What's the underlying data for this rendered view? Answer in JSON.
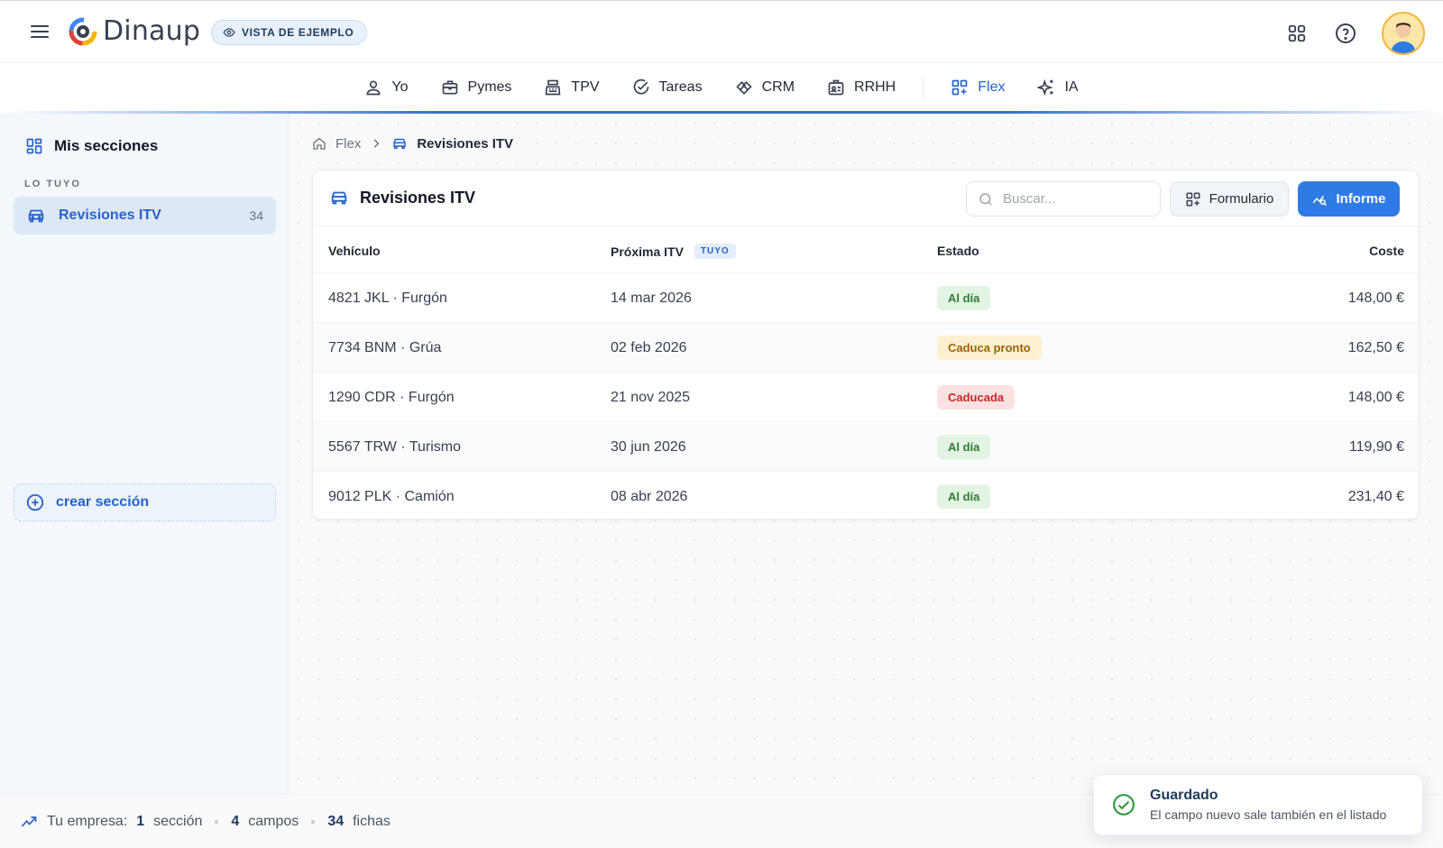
{
  "app": {
    "name": "Dinaup",
    "demo_badge": "VISTA DE EJEMPLO"
  },
  "topnav": {
    "items": [
      {
        "label": "Yo",
        "icon": "user-icon"
      },
      {
        "label": "Pymes",
        "icon": "briefcase-icon"
      },
      {
        "label": "TPV",
        "icon": "cash-register-icon"
      },
      {
        "label": "Tareas",
        "icon": "check-circle-icon"
      },
      {
        "label": "CRM",
        "icon": "handshake-icon"
      },
      {
        "label": "RRHH",
        "icon": "id-card-icon"
      },
      {
        "label": "Flex",
        "icon": "grid-plus-icon",
        "active": true
      },
      {
        "label": "IA",
        "icon": "sparkles-icon"
      }
    ]
  },
  "sidebar": {
    "title": "Mis secciones",
    "section_label": "LO TUYO",
    "items": [
      {
        "label": "Revisiones ITV",
        "count": "34",
        "icon": "car-icon"
      }
    ],
    "create_label": "crear sección"
  },
  "breadcrumb": {
    "root": "Flex",
    "current": "Revisiones ITV"
  },
  "table_card": {
    "title": "Revisiones ITV",
    "search_placeholder": "Buscar...",
    "form_button": "Formulario",
    "report_button": "Informe",
    "columns": [
      "Vehículo",
      "Próxima ITV",
      "Estado",
      "Coste"
    ],
    "column_tag": "TUYO",
    "rows": [
      {
        "vehicle": "4821 JKL · Furgón",
        "next_itv": "14 mar 2026",
        "status": "Al día",
        "status_kind": "ok",
        "cost": "148,00 €"
      },
      {
        "vehicle": "7734 BNM · Grúa",
        "next_itv": "02 feb 2026",
        "status": "Caduca pronto",
        "status_kind": "warn",
        "cost": "162,50 €"
      },
      {
        "vehicle": "1290 CDR · Furgón",
        "next_itv": "21 nov 2025",
        "status": "Caducada",
        "status_kind": "bad",
        "cost": "148,00 €"
      },
      {
        "vehicle": "5567 TRW · Turismo",
        "next_itv": "30 jun 2026",
        "status": "Al día",
        "status_kind": "ok",
        "cost": "119,90 €"
      },
      {
        "vehicle": "9012 PLK · Camión",
        "next_itv": "08 abr 2026",
        "status": "Al día",
        "status_kind": "ok",
        "cost": "231,40 €"
      }
    ]
  },
  "footer": {
    "prefix": "Tu empresa:",
    "sections_count": "1",
    "sections_label": "sección",
    "fields_count": "4",
    "fields_label": "campos",
    "records_count": "34",
    "records_label": "fichas"
  },
  "toast": {
    "title": "Guardado",
    "message": "El campo nuevo sale también en el listado"
  },
  "colors": {
    "accent": "#2563c9",
    "primary_button": "#2f7be6",
    "status_ok": "#2e7d32",
    "status_warn": "#9a6409",
    "status_bad": "#c62828"
  }
}
